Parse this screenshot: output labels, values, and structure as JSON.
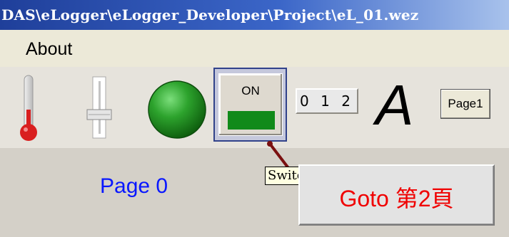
{
  "window": {
    "title": "DAS\\eLogger\\eLogger_Developer\\Project\\eL_01.wez"
  },
  "menubar": {
    "items": [
      {
        "label": "About"
      }
    ]
  },
  "toolbar": {
    "thermometer_icon": "thermometer-icon",
    "slider_icon": "vertical-slider-icon",
    "led_icon": "green-led-icon",
    "switch": {
      "label": "ON",
      "lamp_color": "#118a1a"
    },
    "digit_display": "0 1 2",
    "text_object": "A",
    "page_button": "Page1"
  },
  "tooltip": {
    "text": "Switch"
  },
  "main": {
    "page_label": "Page 0",
    "goto_button": "Goto 第2頁"
  },
  "colors": {
    "page_label": "#0a18ff",
    "goto_text": "#f00000",
    "title_bar": "#1f3f9a"
  }
}
